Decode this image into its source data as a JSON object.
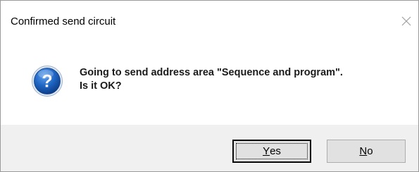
{
  "dialog": {
    "title": "Confirmed send circuit",
    "message_line1": "Going to send address area \"Sequence and program\".",
    "message_line2": "Is it OK?",
    "icon": "question-icon",
    "close_icon": "close-icon"
  },
  "buttons": {
    "yes": {
      "mnemonic": "Y",
      "rest": "es",
      "label": "Yes"
    },
    "no": {
      "mnemonic": "N",
      "rest": "o",
      "label": "No"
    }
  },
  "colors": {
    "footer_bg": "#f0f0f0",
    "icon_blue": "#1b5fb5",
    "button_face": "#e1e1e1"
  }
}
